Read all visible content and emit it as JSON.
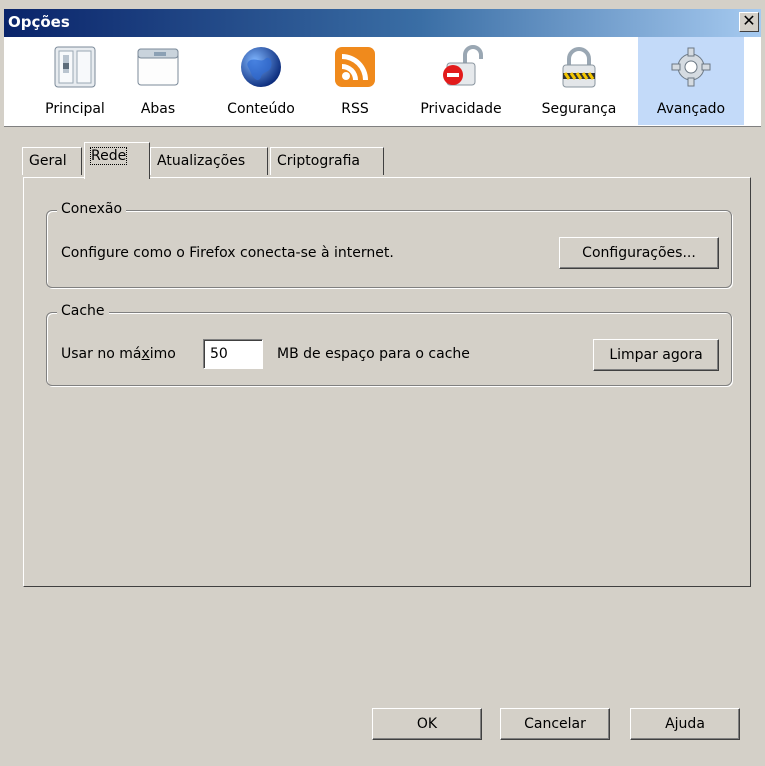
{
  "window": {
    "title": "Opções",
    "close_glyph": "✕"
  },
  "panes": [
    {
      "label": "Principal",
      "icon": "switch-icon"
    },
    {
      "label": "Abas",
      "icon": "window-tabs-icon"
    },
    {
      "label": "Conteúdo",
      "icon": "globe-icon"
    },
    {
      "label": "RSS",
      "icon": "rss-icon"
    },
    {
      "label": "Privacidade",
      "icon": "lock-open-icon"
    },
    {
      "label": "Segurança",
      "icon": "padlock-icon"
    },
    {
      "label": "Avançado",
      "icon": "gear-icon",
      "selected": true
    }
  ],
  "tabs": [
    {
      "label": "Geral"
    },
    {
      "label": "Rede",
      "active": true
    },
    {
      "label": "Atualizações"
    },
    {
      "label": "Criptografia"
    }
  ],
  "connection": {
    "legend": "Conexão",
    "description": "Configure como o Firefox conecta-se à internet.",
    "settings_button": "Configurações..."
  },
  "cache": {
    "legend": "Cache",
    "label_prefix": "Usar no má",
    "label_accel": "x",
    "label_suffix": "imo",
    "value": "50",
    "unit_text": "MB de espaço para o cache",
    "clear_button": "Limpar agora"
  },
  "footer": {
    "ok": "OK",
    "cancel": "Cancelar",
    "help": "Ajuda"
  },
  "colors": {
    "title_start": "#0a246a",
    "title_end": "#a6caf0",
    "selected_pane": "#c3daf9",
    "dialog_bg": "#d4d0c8"
  }
}
